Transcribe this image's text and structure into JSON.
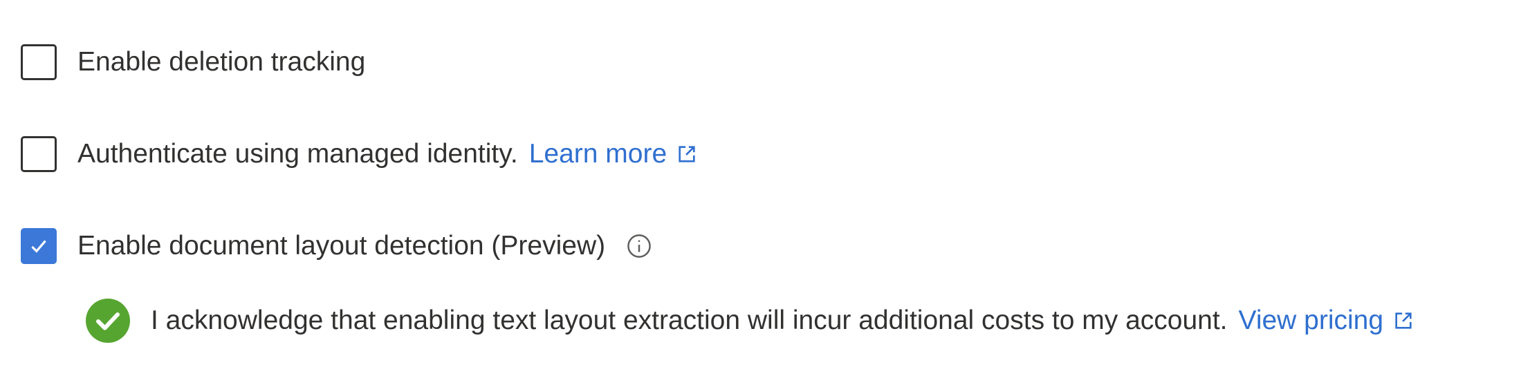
{
  "options": {
    "deletion_tracking": {
      "label": "Enable deletion tracking",
      "checked": false
    },
    "managed_identity": {
      "label": "Authenticate using managed identity.",
      "link": "Learn more",
      "checked": false
    },
    "layout_detection": {
      "label": "Enable document layout detection (Preview)",
      "checked": true
    }
  },
  "acknowledgement": {
    "text": "I acknowledge that enabling text layout extraction will incur additional costs to my account.",
    "link": "View pricing"
  },
  "icons": {
    "checkmark": "checkmark-icon",
    "external_link": "external-link-icon",
    "info": "info-icon",
    "success": "success-check-icon"
  },
  "colors": {
    "accent": "#3c78d8",
    "link": "#2f6fcf",
    "success": "#57a531",
    "text": "#323130"
  }
}
